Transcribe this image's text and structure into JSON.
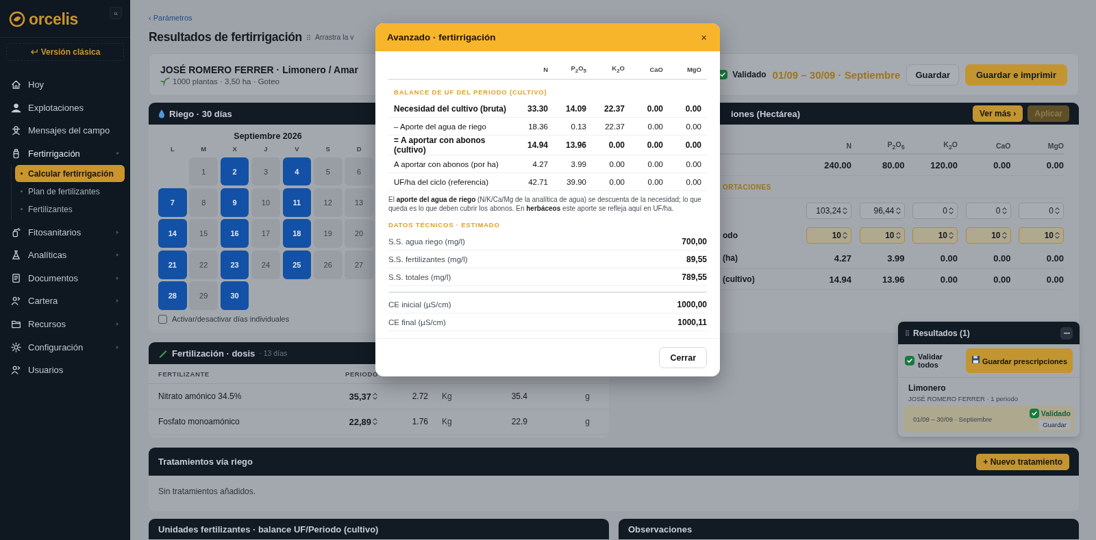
{
  "sidebar": {
    "logo": "orcelis",
    "collapse": "«",
    "classic_button": "Versión clásica",
    "items": [
      {
        "label": "Hoy",
        "kind": "link"
      },
      {
        "label": "Explotaciones",
        "kind": "link"
      },
      {
        "label": "Mensajes del campo",
        "kind": "link"
      },
      {
        "label": "Fertirrigación",
        "kind": "group",
        "expanded": true,
        "children": [
          {
            "label": "Calcular fertirrigación",
            "selected": true
          },
          {
            "label": "Plan de fertilizantes",
            "selected": false
          },
          {
            "label": "Fertilizantes",
            "selected": false
          }
        ]
      },
      {
        "label": "Fitosanitarios",
        "kind": "group",
        "expanded": false
      },
      {
        "label": "Analíticas",
        "kind": "group",
        "expanded": false
      },
      {
        "label": "Documentos",
        "kind": "group",
        "expanded": false
      },
      {
        "label": "Cartera",
        "kind": "group",
        "expanded": false
      },
      {
        "label": "Recursos",
        "kind": "group",
        "expanded": false
      },
      {
        "label": "Configuración",
        "kind": "group",
        "expanded": false
      },
      {
        "label": "Usuarios",
        "kind": "link"
      }
    ]
  },
  "breadcrumb": "‹ Parámetros",
  "page_title": "Resultados de fertirrigación",
  "drag_hint": "Arrastra la v",
  "header_card": {
    "title": "JOSÉ ROMERO FERRER · Limonero / Amar",
    "subtitle": "1000 plantas · 3,50 ha · Goteo",
    "validated": true,
    "status": "Validado",
    "period": "01/09 – 30/09 · Septiembre",
    "buttons": [
      {
        "label": "Guardar",
        "kind": "secondary"
      },
      {
        "label": "Guardar e imprimir",
        "kind": "primary"
      }
    ]
  },
  "riego": {
    "title": "Riego · 30 días",
    "month": "Septiembre 2026",
    "weekdays": [
      "L",
      "M",
      "X",
      "J",
      "V",
      "S",
      "D"
    ],
    "days": [
      {
        "label": "1",
        "selected": false
      },
      {
        "label": "2",
        "selected": true
      },
      {
        "label": "3",
        "selected": false
      },
      {
        "label": "4",
        "selected": true
      },
      {
        "label": "5",
        "selected": false
      },
      {
        "label": "6",
        "selected": false
      },
      {
        "label": "7",
        "selected": true
      },
      {
        "label": "8",
        "selected": false
      },
      {
        "label": "9",
        "selected": true
      },
      {
        "label": "10",
        "selected": false
      },
      {
        "label": "11",
        "selected": true
      },
      {
        "label": "12",
        "selected": false
      },
      {
        "label": "13",
        "selected": false
      },
      {
        "label": "14",
        "selected": true
      },
      {
        "label": "15",
        "selected": false
      },
      {
        "label": "16",
        "selected": true
      },
      {
        "label": "17",
        "selected": false
      },
      {
        "label": "18",
        "selected": true
      },
      {
        "label": "19",
        "selected": false
      },
      {
        "label": "20",
        "selected": false
      },
      {
        "label": "21",
        "selected": true
      },
      {
        "label": "22",
        "selected": false
      },
      {
        "label": "23",
        "selected": true
      },
      {
        "label": "24",
        "selected": false
      },
      {
        "label": "25",
        "selected": true
      },
      {
        "label": "26",
        "selected": false
      },
      {
        "label": "27",
        "selected": false
      },
      {
        "label": "28",
        "selected": true
      },
      {
        "label": "29",
        "selected": false
      },
      {
        "label": "30",
        "selected": true
      }
    ],
    "toggle": {
      "label": "Activar/desactivar días individuales",
      "checked": false
    }
  },
  "aportaciones": {
    "title": "iones (Hectárea)",
    "buttons": [
      {
        "label": "Ver más ›",
        "disabled": false
      },
      {
        "label": "Aplicar",
        "disabled": true
      }
    ],
    "columns": [
      "N",
      "P$_{2}$O$_{5}$",
      "K$_{2}$O",
      "CaO",
      "MgO"
    ],
    "rows": [
      {
        "kind": "value",
        "values": [
          "240.00",
          "80.00",
          "120.00",
          "0.00",
          "0.00"
        ]
      },
      {
        "kind": "section",
        "label": "ORTACIONES"
      },
      {
        "kind": "input",
        "values": [
          "103,24",
          "96,44",
          "0",
          "0",
          "0"
        ]
      },
      {
        "kind": "highlight_input",
        "label": "odo",
        "values": [
          "10",
          "10",
          "10",
          "10",
          "10"
        ]
      },
      {
        "kind": "value",
        "label": "(ha)",
        "values": [
          "4.27",
          "3.99",
          "0.00",
          "0.00",
          "0.00"
        ]
      },
      {
        "kind": "value",
        "label": "(cultivo)",
        "values": [
          "14.94",
          "13.96",
          "0.00",
          "0.00",
          "0.00"
        ]
      }
    ]
  },
  "fertilizacion": {
    "title": "Fertilización · dosis",
    "subtitle": "· 13 días",
    "columns": [
      "FERTILIZANTE",
      "PERIODO"
    ],
    "rows": [
      {
        "name": "Nitrato amónico 34.5%",
        "periodo": "35,37",
        "column_3": "2.72",
        "column_4": "Kg",
        "column_5": "35.4",
        "column_6": "g"
      },
      {
        "name": "Fosfato monoamónico",
        "periodo": "22,89",
        "column_3": "1.76",
        "column_4": "Kg",
        "column_5": "22.9",
        "column_6": "g"
      }
    ]
  },
  "tratamientos": {
    "title": "Tratamientos vía riego",
    "button": "+ Nuevo tratamiento",
    "empty": "Sin tratamientos añadidos."
  },
  "bottom_cards": [
    "Unidades fertilizantes · balance UF/Periodo (cultivo)",
    "Observaciones"
  ],
  "results_panel": {
    "title": "Resultados (1)",
    "validate_all": {
      "label": "Validar todos",
      "checked": true
    },
    "save_button": "Guardar prescripciones",
    "crop": "Limonero",
    "owner": "JOSÉ ROMERO FERRER · 1 periodo",
    "period": {
      "label": "01/09 – 30/09 · Septiembre",
      "validated": true,
      "status": "Validado",
      "button": "Guardar"
    }
  },
  "modal": {
    "title": "Avanzado · fertirrigación",
    "close": "×",
    "columns": [
      "N",
      "P$_{2}$O$_{5}$",
      "K$_{2}$O",
      "CaO",
      "MgO"
    ],
    "balance_title": "BALANCE DE UF DEL PERIODO (CULTIVO)",
    "rows": [
      {
        "label": "Necesidad del cultivo (bruta)",
        "kind": "total",
        "values": [
          "33.30",
          "14.09",
          "22.37",
          "0.00",
          "0.00"
        ]
      },
      {
        "label": "– Aporte del agua de riego",
        "kind": "line",
        "values": [
          "18.36",
          "0.13",
          "22.37",
          "0.00",
          "0.00"
        ]
      },
      {
        "label": "= A aportar con abonos (cultivo)",
        "kind": "total",
        "values": [
          "14.94",
          "13.96",
          "0.00",
          "0.00",
          "0.00"
        ]
      },
      {
        "label": "A aportar con abonos (por ha)",
        "kind": "line",
        "values": [
          "4.27",
          "3.99",
          "0.00",
          "0.00",
          "0.00"
        ]
      },
      {
        "label": "UF/ha del ciclo (referencia)",
        "kind": "line",
        "values": [
          "42.71",
          "39.90",
          "0.00",
          "0.00",
          "0.00"
        ]
      }
    ],
    "note": "El **aporte del agua de riego** (N/K/Ca/Mg de la analítica de agua) se descuenta de la necesidad; lo que queda es lo que deben cubrir los abonos. En **herbáceos** este aporte se refleja aquí en UF/ha.",
    "tech_title": "DATOS TÉCNICOS · ESTIMADO",
    "tech_rows": [
      {
        "label": "S.S. agua riego (mg/l)",
        "value": "700,00"
      },
      {
        "label": "S.S. fertilizantes (mg/l)",
        "value": "89,55"
      },
      {
        "label": "S.S. totales (mg/l)",
        "value": "789,55"
      }
    ],
    "ce_rows": [
      {
        "label": "CE inicial (µS/cm)",
        "value": "1000,00"
      },
      {
        "label": "CE final (µS/cm)",
        "value": "1000,11"
      }
    ],
    "button": "Cerrar"
  }
}
